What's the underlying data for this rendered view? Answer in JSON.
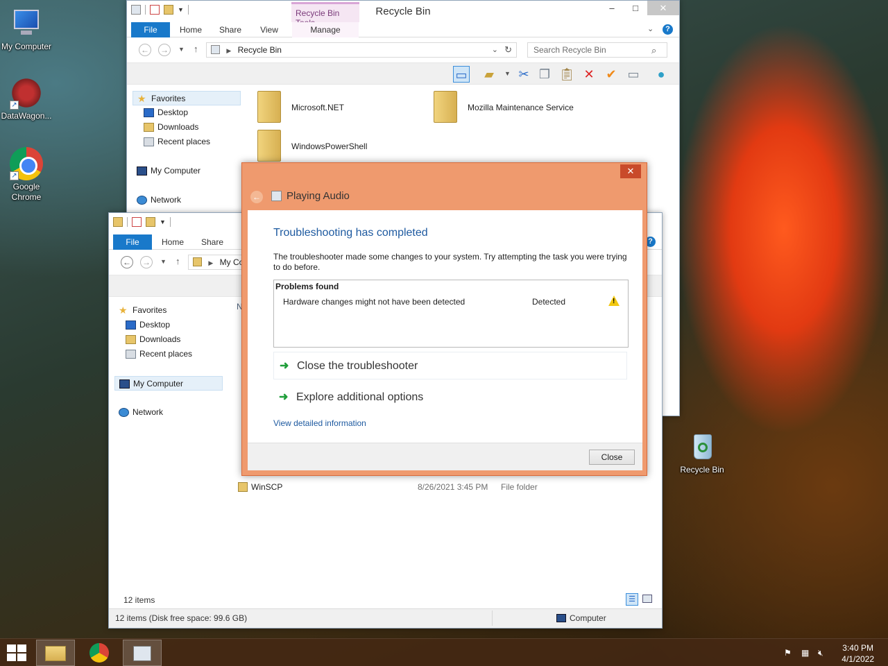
{
  "desktop": {
    "icons": [
      {
        "label": "My Computer"
      },
      {
        "label": "DataWagon..."
      },
      {
        "label": "Google Chrome"
      },
      {
        "label": "Recycle Bin"
      }
    ]
  },
  "recycle_window": {
    "title": "Recycle Bin",
    "context_tab": "Recycle Bin Tools",
    "tabs": [
      "File",
      "Home",
      "Share",
      "View",
      "Manage"
    ],
    "address": "Recycle Bin",
    "search_placeholder": "Search Recycle Bin",
    "nav": {
      "favorites": "Favorites",
      "desktop": "Desktop",
      "downloads": "Downloads",
      "recent": "Recent places",
      "my_computer": "My Computer",
      "network": "Network"
    },
    "folders": [
      "Microsoft.NET",
      "Mozilla Maintenance Service",
      "WindowsPowerShell"
    ]
  },
  "explorer_window": {
    "tabs": [
      "File",
      "Home",
      "Share"
    ],
    "address": "My Cor",
    "nav": {
      "favorites": "Favorites",
      "desktop": "Desktop",
      "downloads": "Downloads",
      "recent": "Recent places",
      "my_computer": "My Computer",
      "network": "Network"
    },
    "column_header_partial": "N",
    "row": {
      "name": "WinSCP",
      "date": "8/26/2021 3:45 PM",
      "type": "File folder"
    },
    "items_count": "12 items",
    "status_left": "12 items (Disk free space: 99.6 GB)",
    "status_right": "Computer"
  },
  "troubleshooter": {
    "window_title": "Playing Audio",
    "heading": "Troubleshooting has completed",
    "description": "The troubleshooter made some changes to your system. Try attempting the task you were trying to do before.",
    "problems_header": "Problems found",
    "problem": {
      "issue": "Hardware changes might not have been detected",
      "status": "Detected"
    },
    "options": [
      "Close the troubleshooter",
      "Explore additional options"
    ],
    "details_link": "View detailed information",
    "close_button": "Close"
  },
  "taskbar": {
    "time": "3:40 PM",
    "date": "4/1/2022"
  },
  "colors": {
    "accent": "#1979ca",
    "dialog_frame": "#ef9a6e",
    "link": "#1e5aa0"
  }
}
